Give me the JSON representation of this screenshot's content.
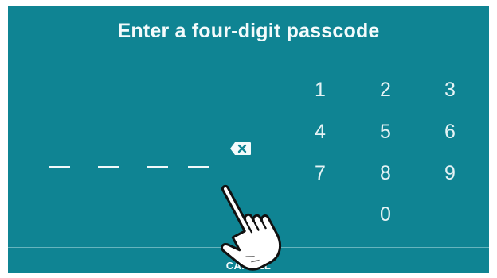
{
  "title": "Enter a four-digit passcode",
  "passcode": {
    "entered_digits": 0,
    "max_digits": 4
  },
  "keypad": {
    "keys": [
      "1",
      "2",
      "3",
      "4",
      "5",
      "6",
      "7",
      "8",
      "9",
      "0"
    ]
  },
  "footer": {
    "cancel_label": "CANCEL"
  },
  "icons": {
    "backspace": "backspace-icon",
    "pointer": "hand-pointer-icon"
  },
  "colors": {
    "background": "#0f8493",
    "text": "#f4fbfc"
  }
}
